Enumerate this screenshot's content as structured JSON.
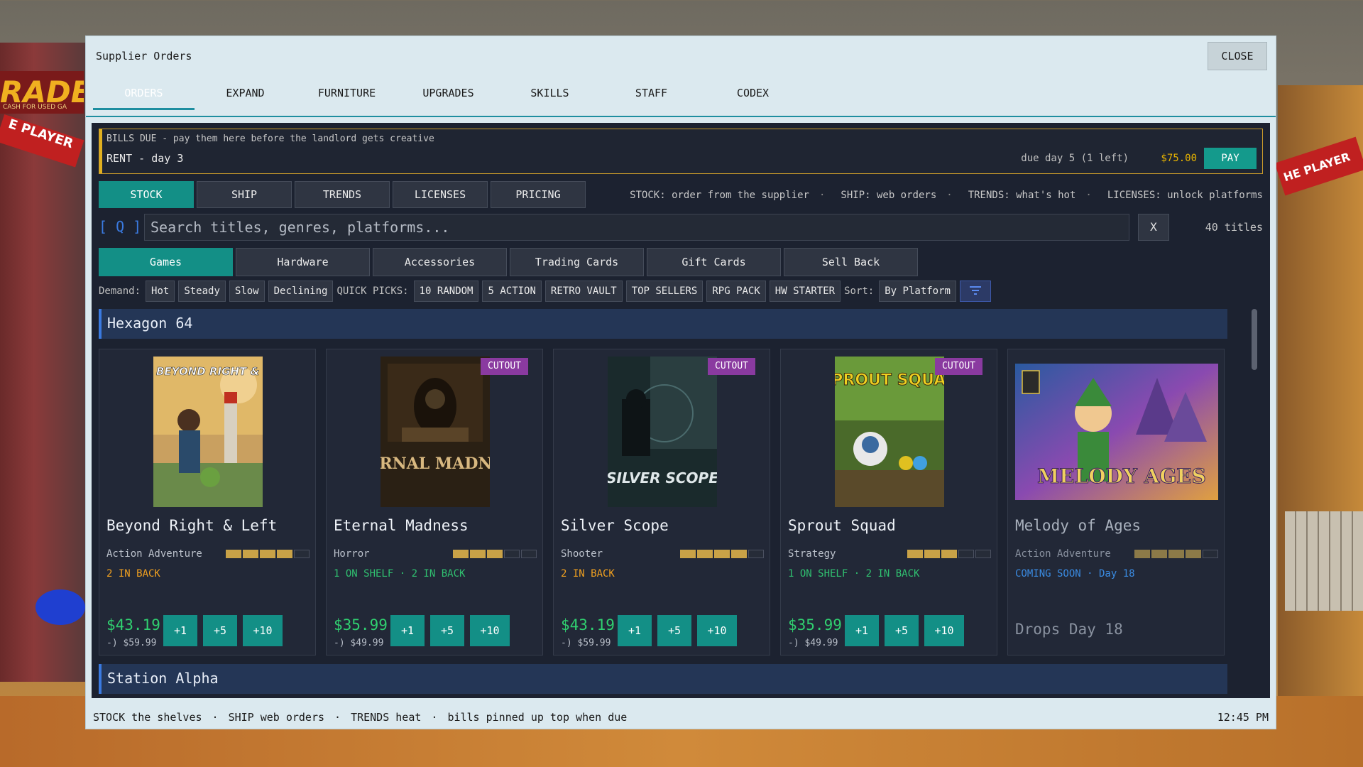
{
  "background": {
    "left_sign": "RADE",
    "left_sign_small": "CASH FOR USED GA",
    "left_banner": "E PLAYER",
    "right_banner": "HE PLAYER"
  },
  "window": {
    "title": "Supplier Orders",
    "close_label": "CLOSE"
  },
  "main_tabs": [
    "ORDERS",
    "EXPAND",
    "FURNITURE",
    "UPGRADES",
    "SKILLS",
    "STAFF",
    "CODEX"
  ],
  "active_main_tab": "ORDERS",
  "bills": {
    "note": "BILLS DUE - pay them here before the landlord gets creative",
    "label": "RENT - day 3",
    "due": "due day 5 (1 left)",
    "amount": "$75.00",
    "pay_label": "PAY"
  },
  "sub_tabs": [
    "STOCK",
    "SHIP",
    "TRENDS",
    "LICENSES",
    "PRICING"
  ],
  "sub_hints": [
    "STOCK: order from the supplier",
    "SHIP: web orders",
    "TRENDS: what's hot",
    "LICENSES: unlock platforms"
  ],
  "search": {
    "icon": "[ Q ]",
    "placeholder": "Search titles, genres, platforms...",
    "clear_label": "X",
    "count": "40 titles"
  },
  "category_tabs": [
    "Games",
    "Hardware",
    "Accessories",
    "Trading Cards",
    "Gift Cards",
    "Sell Back"
  ],
  "filters": {
    "demand_label": "Demand:",
    "demand": [
      "Hot",
      "Steady",
      "Slow",
      "Declining"
    ],
    "quick_label": "QUICK PICKS:",
    "quick": [
      "10 RANDOM",
      "5 ACTION",
      "RETRO VAULT",
      "TOP SELLERS",
      "RPG PACK",
      "HW STARTER"
    ],
    "sort_label": "Sort:",
    "sort_value": "By Platform",
    "filter_icon": "filter-icon"
  },
  "platforms": [
    "Hexagon 64",
    "Station Alpha"
  ],
  "games": [
    {
      "title": "Beyond Right & Left",
      "genre": "Action Adventure",
      "demand": 4,
      "stock": "2 IN BACK",
      "price": "$43.19",
      "msrp": "-) $59.99",
      "badge": "",
      "cover_title": "BEYOND RIGHT & LEFT"
    },
    {
      "title": "Eternal Madness",
      "genre": "Horror",
      "demand": 3,
      "stock": "1 ON SHELF · 2 IN BACK",
      "price": "$35.99",
      "msrp": "-) $49.99",
      "badge": "CUTOUT",
      "cover_title": "ETERNAL MADNESS"
    },
    {
      "title": "Silver Scope",
      "genre": "Shooter",
      "demand": 4,
      "stock": "2 IN BACK",
      "price": "$43.19",
      "msrp": "-) $59.99",
      "badge": "CUTOUT",
      "cover_title": "SILVER SCOPE"
    },
    {
      "title": "Sprout Squad",
      "genre": "Strategy",
      "demand": 3,
      "stock": "1 ON SHELF · 2 IN BACK",
      "price": "$35.99",
      "msrp": "-) $49.99",
      "badge": "CUTOUT",
      "cover_title": "SPROUT SQUAD"
    },
    {
      "title": "Melody of Ages",
      "genre": "Action Adventure",
      "demand": 4,
      "stock": "COMING SOON · Day 18",
      "drops": "Drops Day 18",
      "badge": "",
      "cover_title": "MELODY AGES"
    }
  ],
  "qty_buttons": [
    "+1",
    "+5",
    "+10"
  ],
  "statusbar": {
    "items": [
      "STOCK the shelves",
      "SHIP web orders",
      "TRENDS heat",
      "bills pinned up top when due"
    ],
    "clock": "12:45 PM"
  },
  "colors": {
    "accent": "#138f86",
    "price_green": "#30d070",
    "badge_purple": "#8a3aa0",
    "bill_gold": "#e8b400"
  }
}
